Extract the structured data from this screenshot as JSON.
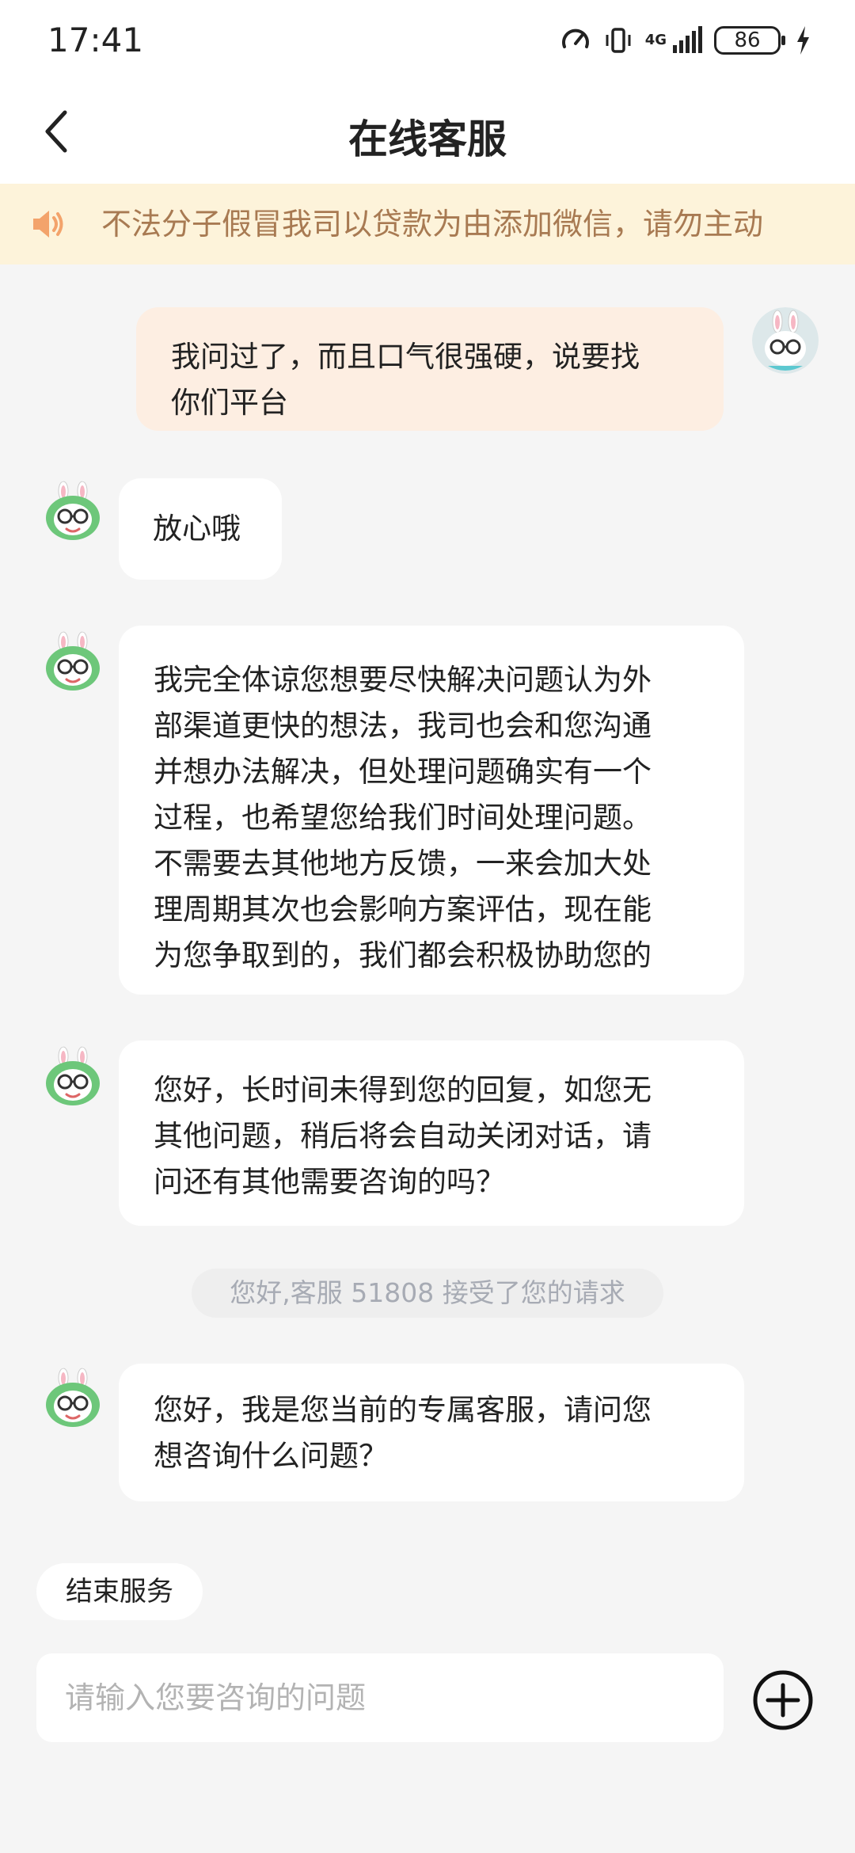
{
  "status_bar": {
    "time": "17:41",
    "icons": [
      "speed-icon",
      "vibrate-icon",
      "network-4g-icon",
      "signal-icon",
      "battery-icon",
      "charging-icon"
    ],
    "network": "4G",
    "battery": "86"
  },
  "header": {
    "title": "在线客服",
    "back_icon": "chevron-left-icon"
  },
  "notice": {
    "icon": "speaker-icon",
    "text": "不法分子假冒我司以贷款为由添加微信，请勿主动"
  },
  "messages": [
    {
      "from": "user",
      "text": "我问过了，而且口气很强硬，说要找\n你们平台"
    },
    {
      "from": "agent",
      "text": "放心哦"
    },
    {
      "from": "agent",
      "text": "我完全体谅您想要尽快解决问题认为外\n部渠道更快的想法，我司也会和您沟通\n并想办法解决，但处理问题确实有一个\n过程，也希望您给我们时间处理问题。\n不需要去其他地方反馈，一来会加大处\n理周期其次也会影响方案评估，现在能\n为您争取到的，我们都会积极协助您的"
    },
    {
      "from": "agent",
      "text": "您好，长时间未得到您的回复，如您无\n其他问题，稍后将会自动关闭对话，请\n问还有其他需要咨询的吗？"
    },
    {
      "from": "system",
      "text": "您好,客服 51808 接受了您的请求"
    },
    {
      "from": "agent",
      "text": "您好，我是您当前的专属客服，请问您\n想咨询什么问题？"
    }
  ],
  "footer": {
    "end_service_label": "结束服务",
    "input_placeholder": "请输入您要咨询的问题",
    "input_value": "",
    "plus_icon": "plus-circle-icon"
  },
  "colors": {
    "background": "#f5f5f5",
    "notice_bg": "#fdf3da",
    "notice_text": "#a87a52",
    "speaker": "#f3a36b",
    "user_bubble": "#fdeee2",
    "agent_bubble": "#ffffff",
    "system_text": "#a7abb4"
  }
}
